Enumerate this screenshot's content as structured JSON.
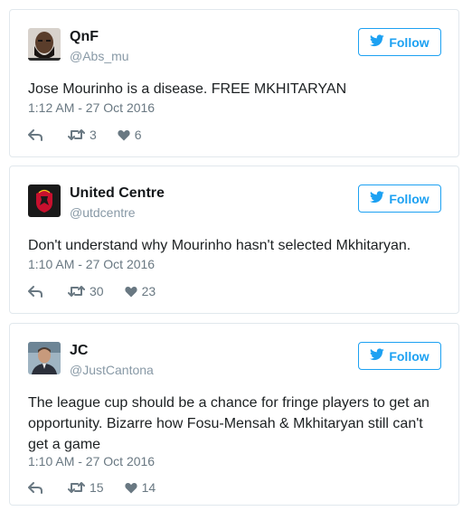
{
  "tweets": [
    {
      "name": "QnF",
      "handle": "@Abs_mu",
      "follow_label": "Follow",
      "text": "Jose Mourinho is a disease. FREE MKHITARYAN",
      "timestamp": "1:12 AM - 27 Oct 2016",
      "retweets": "3",
      "likes": "6",
      "avatar": "bearded-man-avatar"
    },
    {
      "name": "United Centre",
      "handle": "@utdcentre",
      "follow_label": "Follow",
      "text": "Don't understand why Mourinho hasn't selected Mkhitaryan.",
      "timestamp": "1:10 AM - 27 Oct 2016",
      "retweets": "30",
      "likes": "23",
      "avatar": "red-devil-crest-avatar"
    },
    {
      "name": "JC",
      "handle": "@JustCantona",
      "follow_label": "Follow",
      "text": "The league cup should be a chance for fringe players to get an opportunity. Bizarre how Fosu-Mensah & Mkhitaryan still can't get a game",
      "timestamp": "1:10 AM - 27 Oct 2016",
      "retweets": "15",
      "likes": "14",
      "avatar": "man-portrait-avatar"
    }
  ],
  "icons": {
    "follow": "twitter-bird-icon",
    "reply": "reply-icon",
    "retweet": "retweet-icon",
    "like": "heart-icon"
  },
  "colors": {
    "accent": "#1da1f2",
    "text": "#1c2022",
    "muted": "#697882",
    "border": "#e1e8ed"
  }
}
